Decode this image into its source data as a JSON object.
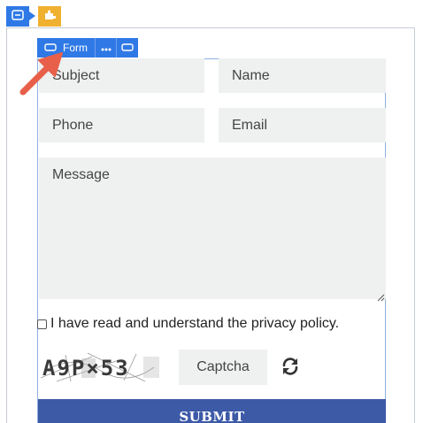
{
  "form_toolbar": {
    "form_label": "Form"
  },
  "fields": {
    "subject_placeholder": "Subject",
    "name_placeholder": "Name",
    "phone_placeholder": "Phone",
    "email_placeholder": "Email",
    "message_placeholder": "Message"
  },
  "privacy": {
    "label": "I have read and understand the privacy policy.",
    "checked": false
  },
  "captcha": {
    "image_text": "A9P×53",
    "input_placeholder": "Captcha"
  },
  "submit": {
    "label": "SUBMIT"
  },
  "icons": {
    "container": "section-icon",
    "widget": "puzzle-icon",
    "form": "field-icon",
    "more": "more-dots-icon",
    "field": "field-icon",
    "refresh": "refresh-icon",
    "annotation": "arrow-pointer"
  },
  "colors": {
    "toolbar_blue": "#2f79e6",
    "toolbar_yellow": "#f0b030",
    "field_bg": "#eff0f0",
    "submit_bg": "#3c5aa6",
    "annotation_arrow": "#e8604a"
  }
}
